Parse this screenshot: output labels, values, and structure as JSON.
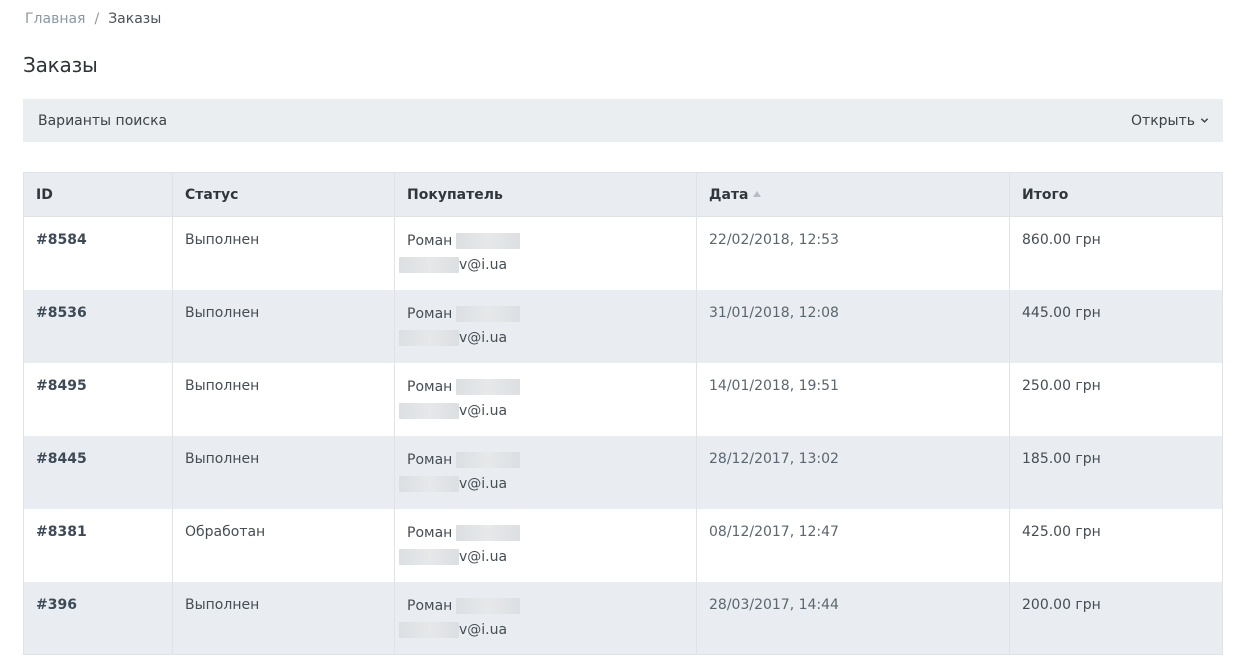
{
  "breadcrumb": {
    "home": "Главная",
    "separator": "/",
    "current": "Заказы"
  },
  "page_title": "Заказы",
  "search": {
    "label": "Варианты поиска",
    "open_label": "Открыть"
  },
  "table": {
    "columns": {
      "id": "ID",
      "status": "Статус",
      "buyer": "Покупатель",
      "date": "Дата",
      "total": "Итого"
    },
    "rows": [
      {
        "id": "#8584",
        "status": "Выполнен",
        "buyer_name": "Роман",
        "buyer_email_suffix": "v@i.ua",
        "date": "22/02/2018, 12:53",
        "total": "860.00 грн"
      },
      {
        "id": "#8536",
        "status": "Выполнен",
        "buyer_name": "Роман",
        "buyer_email_suffix": "v@i.ua",
        "date": "31/01/2018, 12:08",
        "total": "445.00 грн"
      },
      {
        "id": "#8495",
        "status": "Выполнен",
        "buyer_name": "Роман",
        "buyer_email_suffix": "v@i.ua",
        "date": "14/01/2018, 19:51",
        "total": "250.00 грн"
      },
      {
        "id": "#8445",
        "status": "Выполнен",
        "buyer_name": "Роман",
        "buyer_email_suffix": "v@i.ua",
        "date": "28/12/2017, 13:02",
        "total": "185.00 грн"
      },
      {
        "id": "#8381",
        "status": "Обработан",
        "buyer_name": "Роман",
        "buyer_email_suffix": "v@i.ua",
        "date": "08/12/2017, 12:47",
        "total": "425.00 грн"
      },
      {
        "id": "#396",
        "status": "Выполнен",
        "buyer_name": "Роман",
        "buyer_email_suffix": "v@i.ua",
        "date": "28/03/2017, 14:44",
        "total": "200.00 грн"
      }
    ]
  },
  "icons": {
    "open_chevron": "chevron-down-icon",
    "sort": "sort-ascending-icon"
  }
}
